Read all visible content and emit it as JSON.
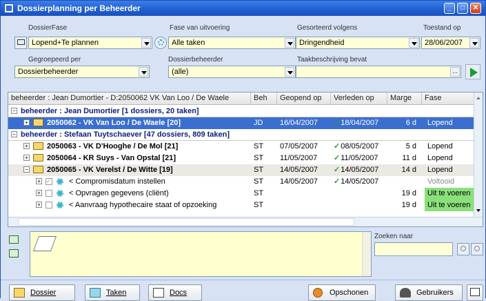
{
  "window": {
    "title": "Dossierplanning per Beheerder"
  },
  "filters": {
    "dossierfase": {
      "label": "DossierFase",
      "value": "Lopend+Te plannen"
    },
    "fase_uitvoering": {
      "label": "Fase van uitvoering",
      "value": "Alle taken"
    },
    "gesorteerd": {
      "label": "Gesorteerd volgens",
      "value": "Dringendheid"
    },
    "toestand": {
      "label": "Toestand op",
      "value": "28/06/2007"
    },
    "gegroepeerd": {
      "label": "Gegroepeerd per",
      "value": "Dossierbeheerder"
    },
    "dossierbeheerder": {
      "label": "Dossierbeheerder",
      "value": "(alle)"
    },
    "taakbeschrijving": {
      "label": "Taakbeschrijving bevat",
      "value": ""
    },
    "ellipsis": "..."
  },
  "grid": {
    "columns": [
      "beheerder : Jean Dumortier - D:2050062 VK Van Loo / De Waele",
      "Beh",
      "Geopend op",
      "Verleden op",
      "Marge",
      "Fase"
    ],
    "rows": [
      {
        "kind": "group",
        "expander": "−",
        "name": "beheerder : Jean Dumortier [1 dossiers, 20 taken]"
      },
      {
        "kind": "dossier",
        "selected": true,
        "expander": "+",
        "name": "2050062 - VK Van Loo / De Waele [20]",
        "beh": "JD",
        "geopend": "16/04/2007",
        "verleden": "18/04/2007",
        "marge": "6 d",
        "fase": "Lopend"
      },
      {
        "kind": "group",
        "expander": "−",
        "name": "beheerder : Stefaan Tuytschaever [47 dossiers, 809 taken]"
      },
      {
        "kind": "dossier",
        "expander": "+",
        "name": "2050063 - VK D'Hooghe / De Mol [21]",
        "beh": "ST",
        "geopend": "07/05/2007",
        "verleden": "08/05/2007",
        "marge": "5 d",
        "fase": "Lopend"
      },
      {
        "kind": "dossier",
        "expander": "+",
        "name": "2050064 - KR Suys - Van Opstal [21]",
        "beh": "ST",
        "geopend": "11/05/2007",
        "verleden": "11/05/2007",
        "marge": "11 d",
        "fase": "Lopend"
      },
      {
        "kind": "dossier",
        "shade": true,
        "expander": "−",
        "name": "2050065 - VK Verelst / De Witte [19]",
        "beh": "ST",
        "geopend": "14/05/2007",
        "verleden": "14/05/2007",
        "marge": "14 d",
        "fase": "Lopend"
      },
      {
        "kind": "task",
        "checked": true,
        "expander": "+",
        "name": "< Compromisdatum instellen",
        "beh": "ST",
        "geopend": "14/05/2007",
        "verleden": "14/05/2007",
        "marge": "",
        "fase": "Voltooid"
      },
      {
        "kind": "task",
        "expander": "+",
        "name": "< Opvragen gegevens (cliënt)",
        "beh": "ST",
        "geopend": "",
        "verleden": "",
        "marge": "19 d",
        "fase": "Uit te voeren"
      },
      {
        "kind": "task",
        "expander": "+",
        "name": "< Aanvraag hypothecaire staat of opzoeking",
        "beh": "ST",
        "geopend": "",
        "verleden": "",
        "marge": "19 d",
        "fase": "Uit te voeren"
      }
    ]
  },
  "search": {
    "label": "Zoeken naar",
    "value": ""
  },
  "buttons": {
    "dossier": "Dossier",
    "taken": "Taken",
    "docs": "Docs",
    "opschonen": "Opschonen",
    "gebruikers": "Gebruikers"
  },
  "colors": {
    "title_bar": "#1f5fd0",
    "selected_row": "#3a6fd0",
    "input_bg": "#ffffd8",
    "uit_te_voeren": "#8be07a"
  }
}
